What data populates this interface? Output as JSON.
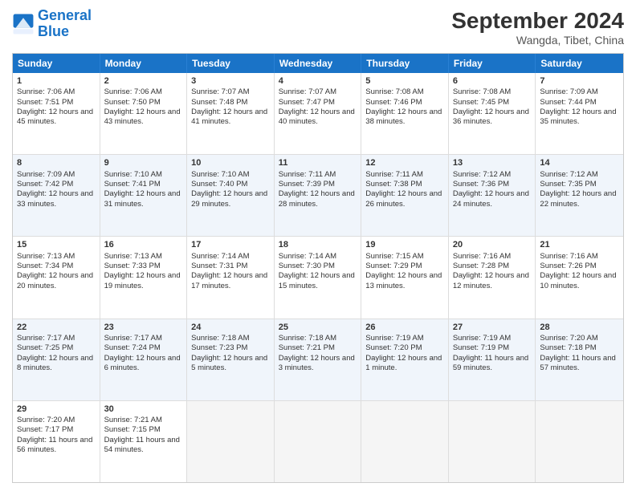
{
  "logo": {
    "line1": "General",
    "line2": "Blue"
  },
  "title": "September 2024",
  "subtitle": "Wangda, Tibet, China",
  "header_days": [
    "Sunday",
    "Monday",
    "Tuesday",
    "Wednesday",
    "Thursday",
    "Friday",
    "Saturday"
  ],
  "rows": [
    [
      {
        "day": "1",
        "sunrise": "7:06 AM",
        "sunset": "7:51 PM",
        "daylight": "12 hours and 45 minutes."
      },
      {
        "day": "2",
        "sunrise": "7:06 AM",
        "sunset": "7:50 PM",
        "daylight": "12 hours and 43 minutes."
      },
      {
        "day": "3",
        "sunrise": "7:07 AM",
        "sunset": "7:48 PM",
        "daylight": "12 hours and 41 minutes."
      },
      {
        "day": "4",
        "sunrise": "7:07 AM",
        "sunset": "7:47 PM",
        "daylight": "12 hours and 40 minutes."
      },
      {
        "day": "5",
        "sunrise": "7:08 AM",
        "sunset": "7:46 PM",
        "daylight": "12 hours and 38 minutes."
      },
      {
        "day": "6",
        "sunrise": "7:08 AM",
        "sunset": "7:45 PM",
        "daylight": "12 hours and 36 minutes."
      },
      {
        "day": "7",
        "sunrise": "7:09 AM",
        "sunset": "7:44 PM",
        "daylight": "12 hours and 35 minutes."
      }
    ],
    [
      {
        "day": "8",
        "sunrise": "7:09 AM",
        "sunset": "7:42 PM",
        "daylight": "12 hours and 33 minutes."
      },
      {
        "day": "9",
        "sunrise": "7:10 AM",
        "sunset": "7:41 PM",
        "daylight": "12 hours and 31 minutes."
      },
      {
        "day": "10",
        "sunrise": "7:10 AM",
        "sunset": "7:40 PM",
        "daylight": "12 hours and 29 minutes."
      },
      {
        "day": "11",
        "sunrise": "7:11 AM",
        "sunset": "7:39 PM",
        "daylight": "12 hours and 28 minutes."
      },
      {
        "day": "12",
        "sunrise": "7:11 AM",
        "sunset": "7:38 PM",
        "daylight": "12 hours and 26 minutes."
      },
      {
        "day": "13",
        "sunrise": "7:12 AM",
        "sunset": "7:36 PM",
        "daylight": "12 hours and 24 minutes."
      },
      {
        "day": "14",
        "sunrise": "7:12 AM",
        "sunset": "7:35 PM",
        "daylight": "12 hours and 22 minutes."
      }
    ],
    [
      {
        "day": "15",
        "sunrise": "7:13 AM",
        "sunset": "7:34 PM",
        "daylight": "12 hours and 20 minutes."
      },
      {
        "day": "16",
        "sunrise": "7:13 AM",
        "sunset": "7:33 PM",
        "daylight": "12 hours and 19 minutes."
      },
      {
        "day": "17",
        "sunrise": "7:14 AM",
        "sunset": "7:31 PM",
        "daylight": "12 hours and 17 minutes."
      },
      {
        "day": "18",
        "sunrise": "7:14 AM",
        "sunset": "7:30 PM",
        "daylight": "12 hours and 15 minutes."
      },
      {
        "day": "19",
        "sunrise": "7:15 AM",
        "sunset": "7:29 PM",
        "daylight": "12 hours and 13 minutes."
      },
      {
        "day": "20",
        "sunrise": "7:16 AM",
        "sunset": "7:28 PM",
        "daylight": "12 hours and 12 minutes."
      },
      {
        "day": "21",
        "sunrise": "7:16 AM",
        "sunset": "7:26 PM",
        "daylight": "12 hours and 10 minutes."
      }
    ],
    [
      {
        "day": "22",
        "sunrise": "7:17 AM",
        "sunset": "7:25 PM",
        "daylight": "12 hours and 8 minutes."
      },
      {
        "day": "23",
        "sunrise": "7:17 AM",
        "sunset": "7:24 PM",
        "daylight": "12 hours and 6 minutes."
      },
      {
        "day": "24",
        "sunrise": "7:18 AM",
        "sunset": "7:23 PM",
        "daylight": "12 hours and 5 minutes."
      },
      {
        "day": "25",
        "sunrise": "7:18 AM",
        "sunset": "7:21 PM",
        "daylight": "12 hours and 3 minutes."
      },
      {
        "day": "26",
        "sunrise": "7:19 AM",
        "sunset": "7:20 PM",
        "daylight": "12 hours and 1 minute."
      },
      {
        "day": "27",
        "sunrise": "7:19 AM",
        "sunset": "7:19 PM",
        "daylight": "11 hours and 59 minutes."
      },
      {
        "day": "28",
        "sunrise": "7:20 AM",
        "sunset": "7:18 PM",
        "daylight": "11 hours and 57 minutes."
      }
    ],
    [
      {
        "day": "29",
        "sunrise": "7:20 AM",
        "sunset": "7:17 PM",
        "daylight": "11 hours and 56 minutes."
      },
      {
        "day": "30",
        "sunrise": "7:21 AM",
        "sunset": "7:15 PM",
        "daylight": "11 hours and 54 minutes."
      },
      null,
      null,
      null,
      null,
      null
    ]
  ],
  "labels": {
    "sunrise": "Sunrise:",
    "sunset": "Sunset:",
    "daylight": "Daylight:"
  }
}
